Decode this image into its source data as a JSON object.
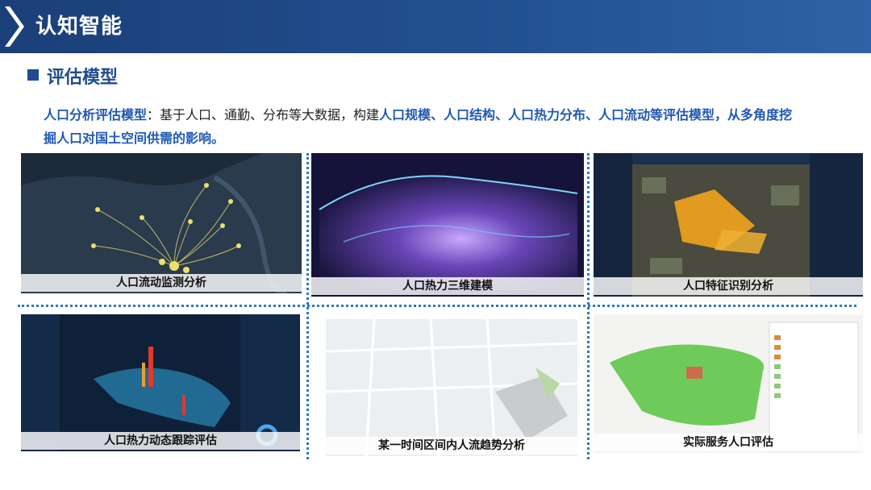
{
  "header": {
    "title": "认知智能"
  },
  "section": {
    "title": "评估模型"
  },
  "description": {
    "lead": "人口分析评估模型",
    "text1": "：基于人口、通勤、分布等大数据，构建",
    "highlight": "人口规模、人口结构、人口热力分布、人口流动等评估模型，从多角度挖",
    "line2": "掘人口对国土空间供需的影响。"
  },
  "panels": [
    {
      "caption": "人口流动监测分析"
    },
    {
      "caption": "人口热力三维建模"
    },
    {
      "caption": "人口特征识别分析"
    },
    {
      "caption": "人口热力动态跟踪评估"
    },
    {
      "caption": "某一时间区间内人流趋势分析"
    },
    {
      "caption": "实际服务人口评估"
    }
  ],
  "colors": {
    "header": "#1b3f78",
    "accent": "#1e4c8f",
    "highlight": "#1f58b5",
    "divider": "#2a78c4"
  }
}
